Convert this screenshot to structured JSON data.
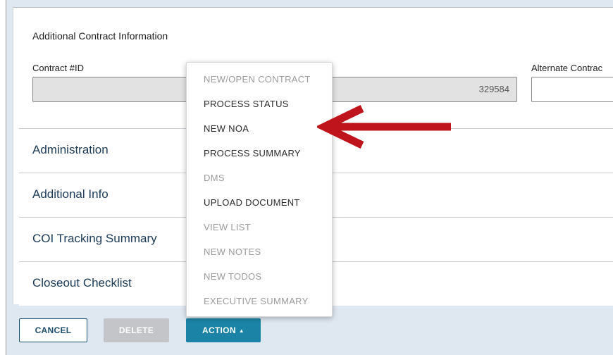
{
  "section": {
    "title": "Additional Contract Information",
    "contract_label": "Contract #ID",
    "contract_value": "329584",
    "alternate_label": "Alternate Contrac",
    "alternate_value": ""
  },
  "rows": [
    {
      "label": "Administration"
    },
    {
      "label": "Additional Info"
    },
    {
      "label": "COI Tracking Summary"
    },
    {
      "label": "Closeout Checklist"
    }
  ],
  "menu": {
    "items": [
      {
        "label": "NEW/OPEN CONTRACT",
        "enabled": false
      },
      {
        "label": "PROCESS STATUS",
        "enabled": true
      },
      {
        "label": "NEW NOA",
        "enabled": true
      },
      {
        "label": "PROCESS SUMMARY",
        "enabled": true
      },
      {
        "label": "DMS",
        "enabled": false
      },
      {
        "label": "UPLOAD DOCUMENT",
        "enabled": true
      },
      {
        "label": "VIEW LIST",
        "enabled": false
      },
      {
        "label": "NEW NOTES",
        "enabled": false
      },
      {
        "label": "NEW TODOS",
        "enabled": false
      },
      {
        "label": "EXECUTIVE SUMMARY",
        "enabled": false
      }
    ]
  },
  "buttons": {
    "cancel": "CANCEL",
    "delete": "DELETE",
    "action": "ACTION",
    "action_caret": "▲"
  },
  "annotation": {
    "arrow_icon": "red-arrow-left-icon",
    "color": "#c0141c"
  }
}
